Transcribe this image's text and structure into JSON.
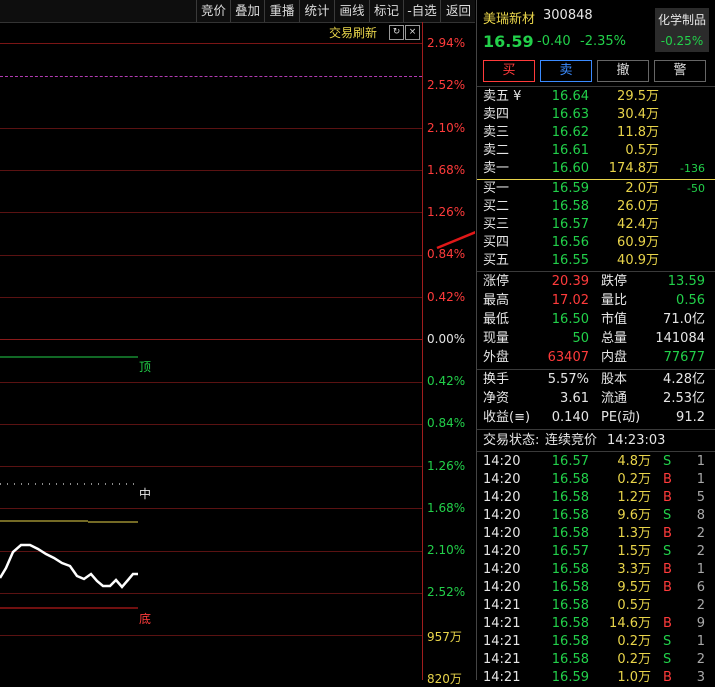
{
  "toolbar": [
    "竞价",
    "叠加",
    "重播",
    "统计",
    "画线",
    "标记",
    "-自选",
    "返回"
  ],
  "chart": {
    "refresh_label": "交易刷新",
    "price_axis": [
      "2.94%",
      "2.52%",
      "2.10%",
      "1.68%",
      "1.26%",
      "0.84%",
      "0.42%",
      "0.00%",
      "0.42%",
      "0.84%",
      "1.26%",
      "1.68%",
      "2.10%",
      "2.52%"
    ],
    "volume_axis": [
      "957万",
      "820万"
    ],
    "marks": {
      "top": "顶",
      "middle": "中",
      "bottom": "底"
    }
  },
  "stock": {
    "name": "美瑞新材",
    "code": "300848",
    "price": "16.59",
    "change": "-0.40",
    "change_pct": "-2.35%",
    "sector": "化学制品",
    "sector_change": "-0.25%"
  },
  "buttons": {
    "buy": "买",
    "sell": "卖",
    "cancel": "撤",
    "alert": "警"
  },
  "asks": [
    {
      "label": "卖五 ¥",
      "price": "16.64",
      "volume": "29.5万",
      "delta": ""
    },
    {
      "label": "卖四",
      "price": "16.63",
      "volume": "30.4万",
      "delta": ""
    },
    {
      "label": "卖三",
      "price": "16.62",
      "volume": "11.8万",
      "delta": ""
    },
    {
      "label": "卖二",
      "price": "16.61",
      "volume": "0.5万",
      "delta": ""
    },
    {
      "label": "卖一",
      "price": "16.60",
      "volume": "174.8万",
      "delta": "-136"
    }
  ],
  "bids": [
    {
      "label": "买一",
      "price": "16.59",
      "volume": "2.0万",
      "delta": "-50"
    },
    {
      "label": "买二",
      "price": "16.58",
      "volume": "26.0万",
      "delta": ""
    },
    {
      "label": "买三",
      "price": "16.57",
      "volume": "42.4万",
      "delta": ""
    },
    {
      "label": "买四",
      "price": "16.56",
      "volume": "60.9万",
      "delta": ""
    },
    {
      "label": "买五",
      "price": "16.55",
      "volume": "40.9万",
      "delta": ""
    }
  ],
  "stats": {
    "limit_up_label": "涨停",
    "limit_up": "20.39",
    "limit_down_label": "跌停",
    "limit_down": "13.59",
    "high_label": "最高",
    "high": "17.02",
    "vol_ratio_label": "量比",
    "vol_ratio": "0.56",
    "low_label": "最低",
    "low": "16.50",
    "mktcap_label": "市值",
    "mktcap": "71.0亿",
    "cur_vol_label": "现量",
    "cur_vol": "50",
    "total_vol_label": "总量",
    "total_vol": "141084",
    "outer_label": "外盘",
    "outer": "63407",
    "inner_label": "内盘",
    "inner": "77677",
    "turnover_label": "换手",
    "turnover": "5.57%",
    "shares_label": "股本",
    "shares": "4.28亿",
    "nav_label": "净资",
    "nav": "3.61",
    "float_label": "流通",
    "float": "2.53亿",
    "eps_label": "收益(≡)",
    "eps": "0.140",
    "pe_label": "PE(动)",
    "pe": "91.2"
  },
  "trade_status": {
    "label": "交易状态:",
    "value": "连续竞价",
    "time": "14:23:03"
  },
  "trades": [
    {
      "time": "14:20",
      "price": "16.57",
      "volume": "4.8万",
      "side": "S",
      "count": "1"
    },
    {
      "time": "14:20",
      "price": "16.58",
      "volume": "0.2万",
      "side": "B",
      "count": "1"
    },
    {
      "time": "14:20",
      "price": "16.58",
      "volume": "1.2万",
      "side": "B",
      "count": "5"
    },
    {
      "time": "14:20",
      "price": "16.58",
      "volume": "9.6万",
      "side": "S",
      "count": "8"
    },
    {
      "time": "14:20",
      "price": "16.58",
      "volume": "1.3万",
      "side": "B",
      "count": "2"
    },
    {
      "time": "14:20",
      "price": "16.57",
      "volume": "1.5万",
      "side": "S",
      "count": "2"
    },
    {
      "time": "14:20",
      "price": "16.58",
      "volume": "3.3万",
      "side": "B",
      "count": "1"
    },
    {
      "time": "14:20",
      "price": "16.58",
      "volume": "9.5万",
      "side": "B",
      "count": "6"
    },
    {
      "time": "14:21",
      "price": "16.58",
      "volume": "0.5万",
      "side": "",
      "count": "2"
    },
    {
      "time": "14:21",
      "price": "16.58",
      "volume": "14.6万",
      "side": "B",
      "count": "9"
    },
    {
      "time": "14:21",
      "price": "16.58",
      "volume": "0.2万",
      "side": "S",
      "count": "1"
    },
    {
      "time": "14:21",
      "price": "16.58",
      "volume": "0.2万",
      "side": "S",
      "count": "2"
    },
    {
      "time": "14:21",
      "price": "16.59",
      "volume": "1.0万",
      "side": "B",
      "count": "3"
    }
  ],
  "colors": {
    "up": "#ff3b3b",
    "down": "#22d04a",
    "volume": "#e8d44a",
    "name": "#e8d44a"
  }
}
